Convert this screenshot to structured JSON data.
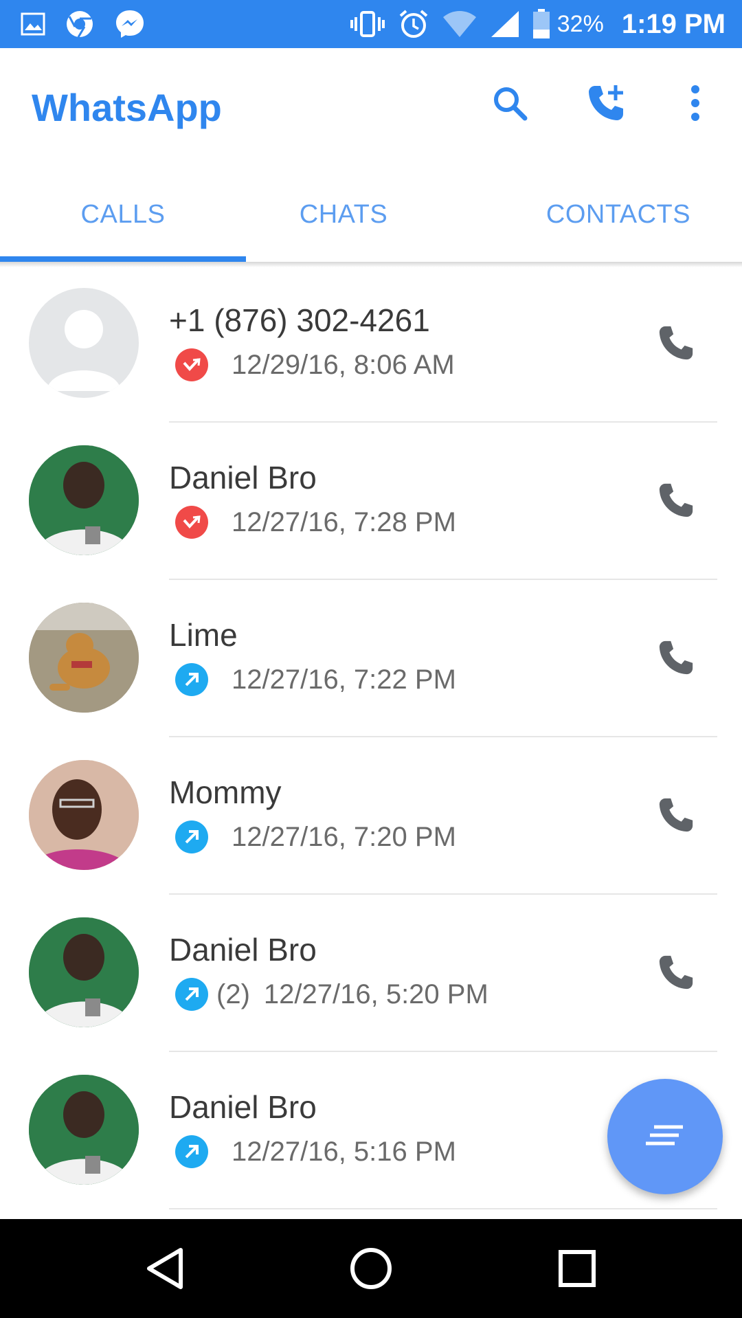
{
  "status_bar": {
    "icons_left": [
      "gallery-icon",
      "chrome-icon",
      "messenger-icon"
    ],
    "icons_right": [
      "vibrate-icon",
      "alarm-icon",
      "wifi-icon",
      "signal-icon",
      "battery-icon"
    ],
    "battery": "32%",
    "time": "1:19 PM"
  },
  "app_bar": {
    "title": "WhatsApp",
    "actions": [
      "search-icon",
      "add-call-icon",
      "more-vert-icon"
    ]
  },
  "tabs": [
    {
      "label": "CALLS",
      "selected": true
    },
    {
      "label": "CHATS",
      "selected": false
    },
    {
      "label": "CONTACTS",
      "selected": false
    }
  ],
  "calls": [
    {
      "name": "+1 (876) 302-4261",
      "direction": "missed",
      "count": "",
      "time": "12/29/16, 8:06 AM",
      "avatar": "default-avatar"
    },
    {
      "name": "Daniel Bro",
      "direction": "missed",
      "count": "",
      "time": "12/27/16, 7:28 PM",
      "avatar": "photo-avatar"
    },
    {
      "name": "Lime",
      "direction": "outgoing",
      "count": "",
      "time": "12/27/16, 7:22 PM",
      "avatar": "dog-photo-avatar"
    },
    {
      "name": "Mommy",
      "direction": "outgoing",
      "count": "",
      "time": "12/27/16, 7:20 PM",
      "avatar": "photo-avatar"
    },
    {
      "name": "Daniel Bro",
      "direction": "outgoing",
      "count": "(2)",
      "time": "12/27/16, 5:20 PM",
      "avatar": "photo-avatar"
    },
    {
      "name": "Daniel Bro",
      "direction": "outgoing",
      "count": "",
      "time": "12/27/16, 5:16 PM",
      "avatar": "photo-avatar"
    }
  ],
  "colors": {
    "accent": "#2f86ee",
    "missed": "#f04a48",
    "outgoing": "#1eaaf1",
    "fab": "#6097f7"
  },
  "fab": {
    "icon": "quick-replies-icon"
  },
  "nav_bar": {
    "buttons": [
      "back-icon",
      "home-icon",
      "recents-icon"
    ]
  }
}
